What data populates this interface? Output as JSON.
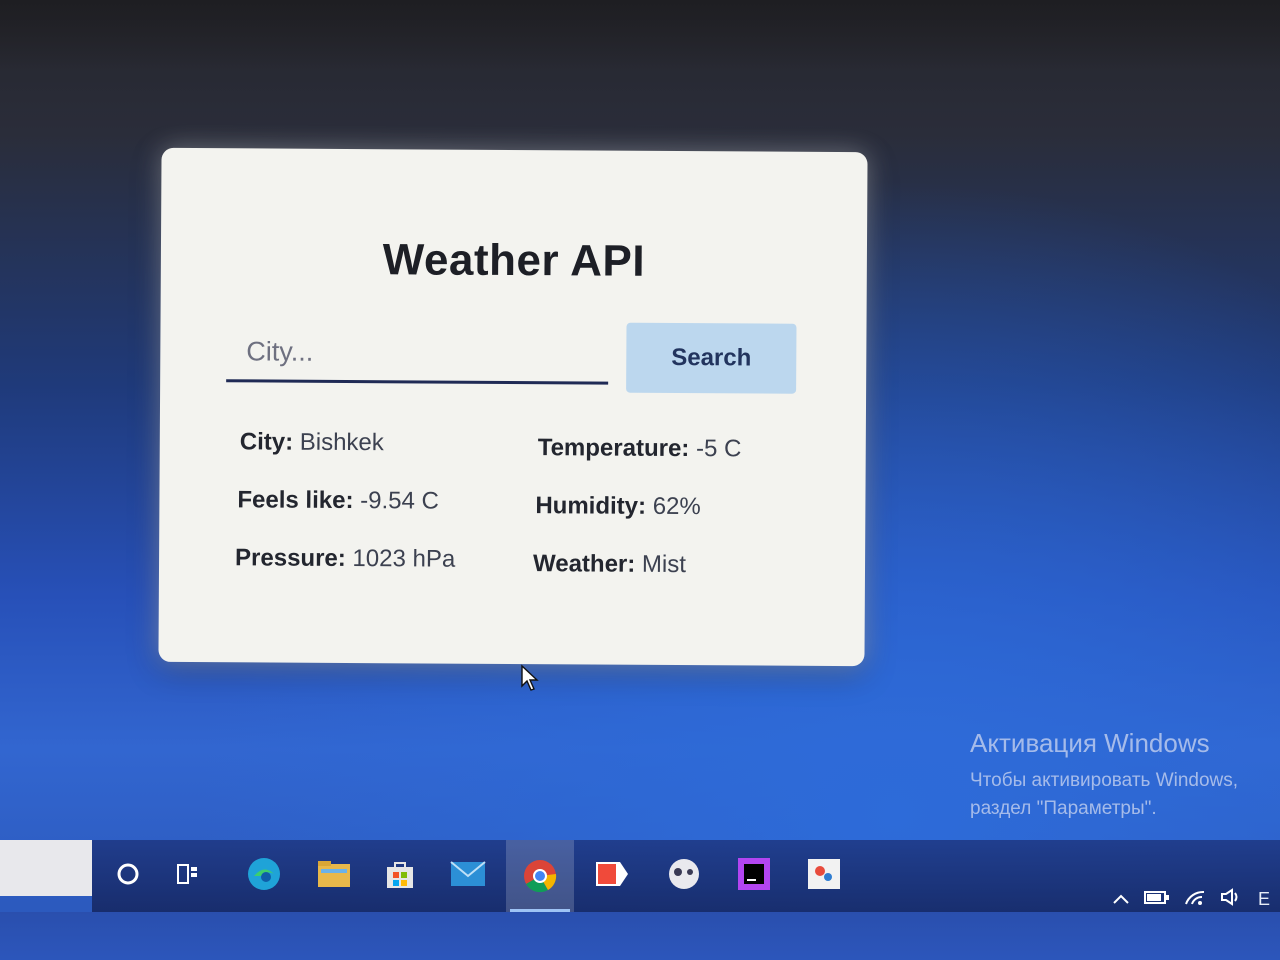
{
  "app": {
    "title": "Weather API",
    "search": {
      "placeholder": "City...",
      "value": "",
      "button_label": "Search"
    },
    "results": [
      {
        "label": "City:",
        "value": "Bishkek"
      },
      {
        "label": "Temperature:",
        "value": "-5 C"
      },
      {
        "label": "Feels like:",
        "value": "-9.54 C"
      },
      {
        "label": "Humidity:",
        "value": "62%"
      },
      {
        "label": "Pressure:",
        "value": "1023 hPa"
      },
      {
        "label": "Weather:",
        "value": "Mist"
      }
    ]
  },
  "watermark": {
    "title": "Активация Windows",
    "line1": "Чтобы активировать Windows,",
    "line2": "раздел \"Параметры\"."
  },
  "taskbar": {
    "items": [
      "search-icon",
      "task-view-icon",
      "edge-icon",
      "file-explorer-icon",
      "store-icon",
      "mail-icon",
      "chrome-icon",
      "yandex-browser-icon",
      "game-controller-icon",
      "phpstorm-icon",
      "paint-icon"
    ],
    "active_item": "chrome-icon",
    "tray": [
      "chevron-up-icon",
      "battery-icon",
      "wifi-icon",
      "volume-icon"
    ],
    "tray_text": "E"
  },
  "colors": {
    "card_bg": "#f3f3ef",
    "button_bg": "#bcd7ee",
    "input_underline": "#1f2a55",
    "desktop_blue": "#2750b8"
  }
}
